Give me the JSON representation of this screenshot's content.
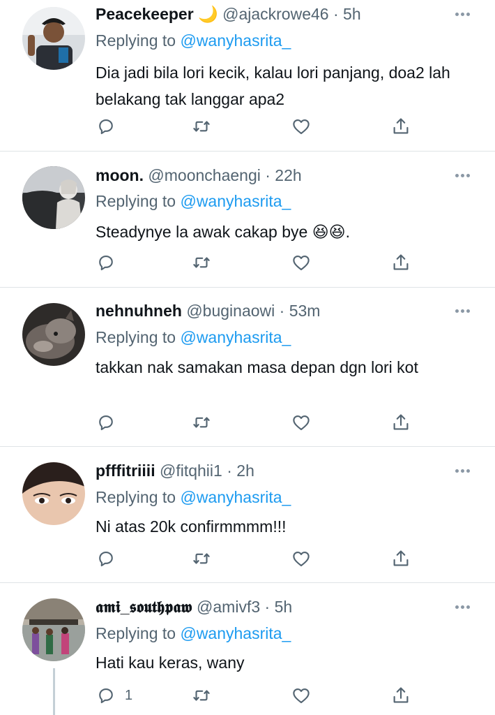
{
  "reply_label": "Replying to",
  "tweets": [
    {
      "name": "Peacekeeper",
      "emoji": "🌙",
      "handle": "@ajackrowe46",
      "dot": "·",
      "time": "5h",
      "mention": "@wanyhasrita_",
      "text": "Dia jadi bila lori kecik, kalau lori panjang, doa2 lah belakang tak langgar apa2",
      "reply_count": ""
    },
    {
      "name": "moon.",
      "handle": "@moonchaengi",
      "dot": "·",
      "time": "22h",
      "mention": "@wanyhasrita_",
      "text": "Steadynye la awak cakap bye 😆😆.",
      "reply_count": ""
    },
    {
      "name": "nehnuhneh",
      "handle": "@buginaowi",
      "dot": "·",
      "time": "53m",
      "mention": "@wanyhasrita_",
      "text": "takkan nak samakan masa depan dgn lori kot",
      "reply_count": ""
    },
    {
      "name": "pfffitriiii",
      "handle": "@fitqhii1",
      "dot": "·",
      "time": "2h",
      "mention": "@wanyhasrita_",
      "text": "Ni atas 20k confirmmmm!!!",
      "reply_count": ""
    },
    {
      "name": "𝖆𝖒𝖎_𝖘𝖔𝖚𝖙𝖍𝖕𝖆𝖜",
      "handle": "@amivf3",
      "dot": "·",
      "time": "5h",
      "mention": "@wanyhasrita_",
      "text": "Hati kau keras, wany",
      "reply_count": "1"
    }
  ],
  "icons": {
    "reply": "reply-icon",
    "retweet": "retweet-icon",
    "like": "heart-icon",
    "share": "share-icon",
    "more": "more-icon"
  },
  "colors": {
    "icon": "#536471",
    "link": "#1d9bf0",
    "divider": "#dfe3e6"
  }
}
